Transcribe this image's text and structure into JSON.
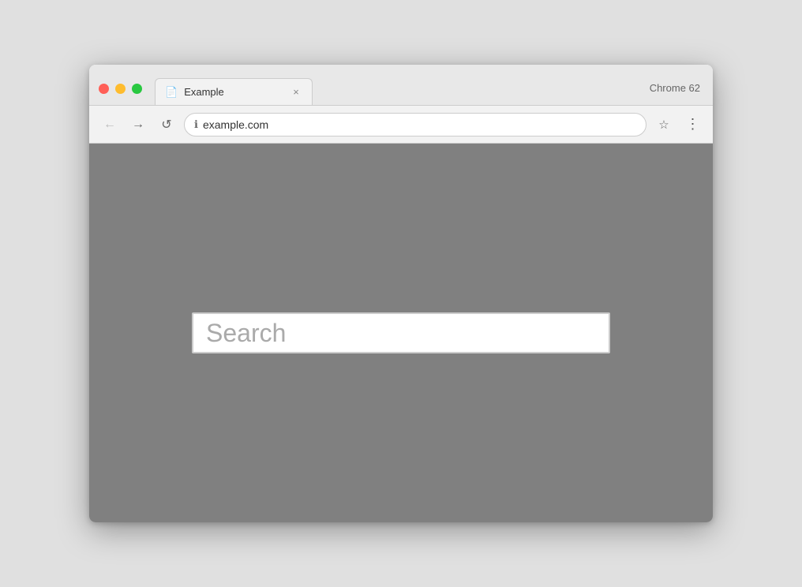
{
  "browser": {
    "chrome_label": "Chrome 62",
    "tab": {
      "title": "Example",
      "icon": "📄"
    },
    "toolbar": {
      "back_label": "←",
      "forward_label": "→",
      "refresh_label": "↺",
      "url": "example.com",
      "bookmark_label": "☆",
      "menu_label": "⋮"
    }
  },
  "page": {
    "search_placeholder": "Search"
  }
}
